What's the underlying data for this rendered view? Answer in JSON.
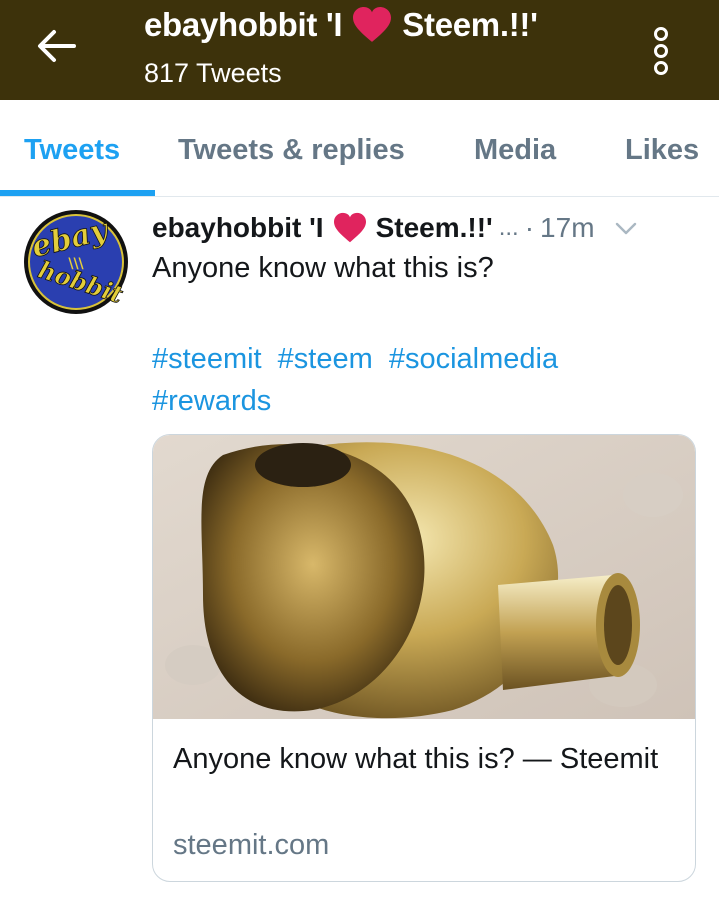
{
  "header": {
    "back_icon": "arrow-left-icon",
    "title_part1": "ebayhobbit 'I",
    "title_part2": "Steem.!!'",
    "tweet_count": "817 Tweets",
    "more_icon": "vertical-dots-icon"
  },
  "tabs": [
    {
      "label": "Tweets",
      "active": true
    },
    {
      "label": "Tweets & replies",
      "active": false
    },
    {
      "label": "Media",
      "active": false
    },
    {
      "label": "Likes",
      "active": false
    }
  ],
  "tweet": {
    "avatar_text_top": "ebay",
    "avatar_text_bottom": "hobbit",
    "name_part1": "ebayhobbit 'I",
    "name_part2": "Steem.!!'",
    "ellipsis": "...",
    "dot": "·",
    "time": "17m",
    "text": "Anyone know what this is?",
    "hashtags": [
      "#steemit",
      "#steem",
      "#socialmedia",
      "#rewards"
    ],
    "card": {
      "title": "Anyone know what this is? — Steemit",
      "domain": "steemit.com"
    }
  },
  "colors": {
    "header_bg": "#3d320b",
    "accent": "#1da1f2",
    "heart": "#e0245e"
  }
}
